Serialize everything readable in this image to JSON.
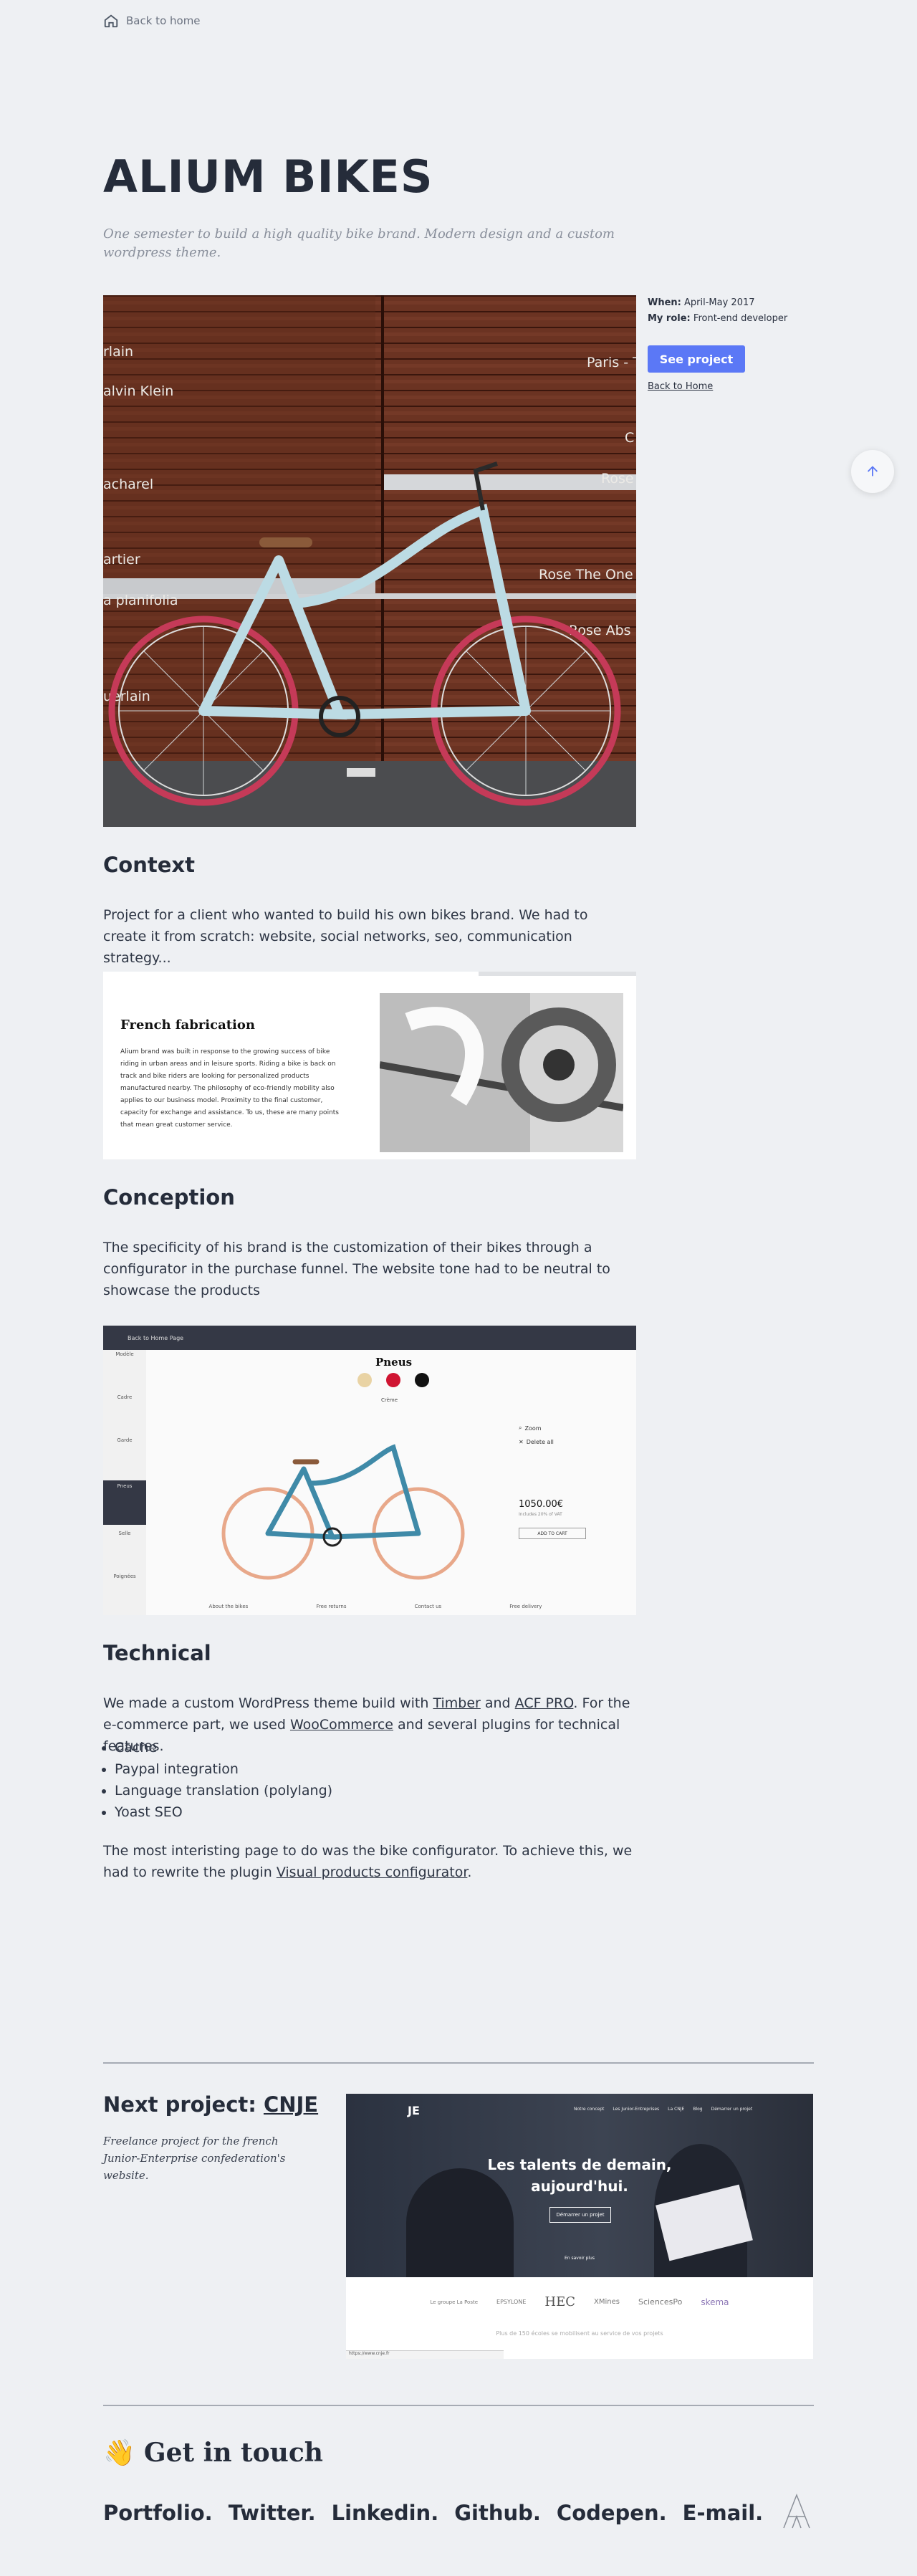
{
  "nav": {
    "back_home": "Back to home"
  },
  "project": {
    "title": "ALIUM BIKES",
    "subtitle": "One semester to build a high quality bike brand. Modern design and a custom wordpress theme.",
    "when_label": "When:",
    "when_value": "April-May 2017",
    "role_label": "My role:",
    "role_value": "Front-end developer",
    "see_project": "See project",
    "back_home": "Back to Home"
  },
  "hero_wall_text": [
    "rlain",
    "alvin Klein",
    "acharel",
    "artier",
    "a planifolia",
    "uerlain",
    "Paris - T",
    "Rose",
    "Rose The One",
    "Rose Abs"
  ],
  "context": {
    "heading": "Context",
    "text": "Project for a client who wanted to build his own bikes brand. We had to create it from scratch: website, social networks, seo, communication strategy..."
  },
  "fabrication": {
    "heading": "French fabrication",
    "text": "Alium brand was built in response to the growing success of bike riding in urban areas and in leisure sports. Riding a bike is back on track and bike riders are looking for personalized products manufactured nearby. The philosophy of eco-friendly mobility also applies to our business model. Proximity to the final customer, capacity for exchange and assistance. To us, these are many points that mean great customer service."
  },
  "conception": {
    "heading": "Conception",
    "text": "The specificity of his brand is the customization of their bikes through a configurator in the purchase funnel. The website tone had to be neutral to showcase the products"
  },
  "configurator": {
    "back": "Back to Home Page",
    "section": "Pneus",
    "color_label": "Crème",
    "sidebar": [
      "Modèle",
      "Cadre",
      "Garde",
      "Pneus",
      "Selle",
      "Poignées"
    ],
    "zoom": "Zoom",
    "delete": "Delete all",
    "price": "1050.00€",
    "price_note": "Includes 20% of VAT",
    "add_to_cart": "ADD TO CART",
    "footer": [
      "About the bikes",
      "Free returns",
      "Contact us",
      "Free delivery"
    ],
    "swatch_colors": [
      "#e9d3a4",
      "#d01532",
      "#111111"
    ]
  },
  "technical": {
    "heading": "Technical",
    "text_1": "We made a custom WordPress theme build with ",
    "link_timber": "Timber",
    "text_2": " and ",
    "link_acf": "ACF PRO",
    "text_3": ". For the e-commerce part, we used ",
    "link_woo": "WooCommerce",
    "text_4": " and several plugins for technical features.",
    "features": [
      "Cache",
      "Paypal integration",
      "Language translation (polylang)",
      "Yoast SEO"
    ],
    "text_5": "The most interisting page to do was the bike configurator. To achieve this, we had to rewrite the plugin ",
    "link_vpc": "Visual products configurator",
    "text_6": "."
  },
  "next": {
    "label": "Next project: ",
    "name": "CNJE",
    "desc": "Freelance project for the french Junior-Enterprise confederation's website.",
    "shot_headline_1": "Les talents de demain,",
    "shot_headline_2": "aujourd'hui.",
    "shot_button": "Démarrer un projet",
    "shot_small": "En savoir plus",
    "shot_nav": [
      "Notre concept",
      "Les Junior-Entreprises",
      "La CNJE",
      "Blog",
      "Démarrer un projet"
    ],
    "shot_partners": [
      "Le groupe La Poste",
      "EPSYLONE",
      "HEC",
      "XMines",
      "SciencesPo",
      "skema"
    ],
    "shot_tagline": "Plus de 150 écoles se mobilisent au service de vos projets",
    "shot_url": "https://www.cnje.fr",
    "shot_logo": "JE"
  },
  "contact": {
    "emoji": "👋",
    "heading": "Get in touch",
    "links": [
      "Portfolio.",
      "Twitter.",
      "Linkedin.",
      "Github.",
      "Codepen.",
      "E-mail."
    ]
  },
  "colors": {
    "accent": "#5b78f6",
    "text": "#252c3a",
    "background": "#eef0f3"
  }
}
